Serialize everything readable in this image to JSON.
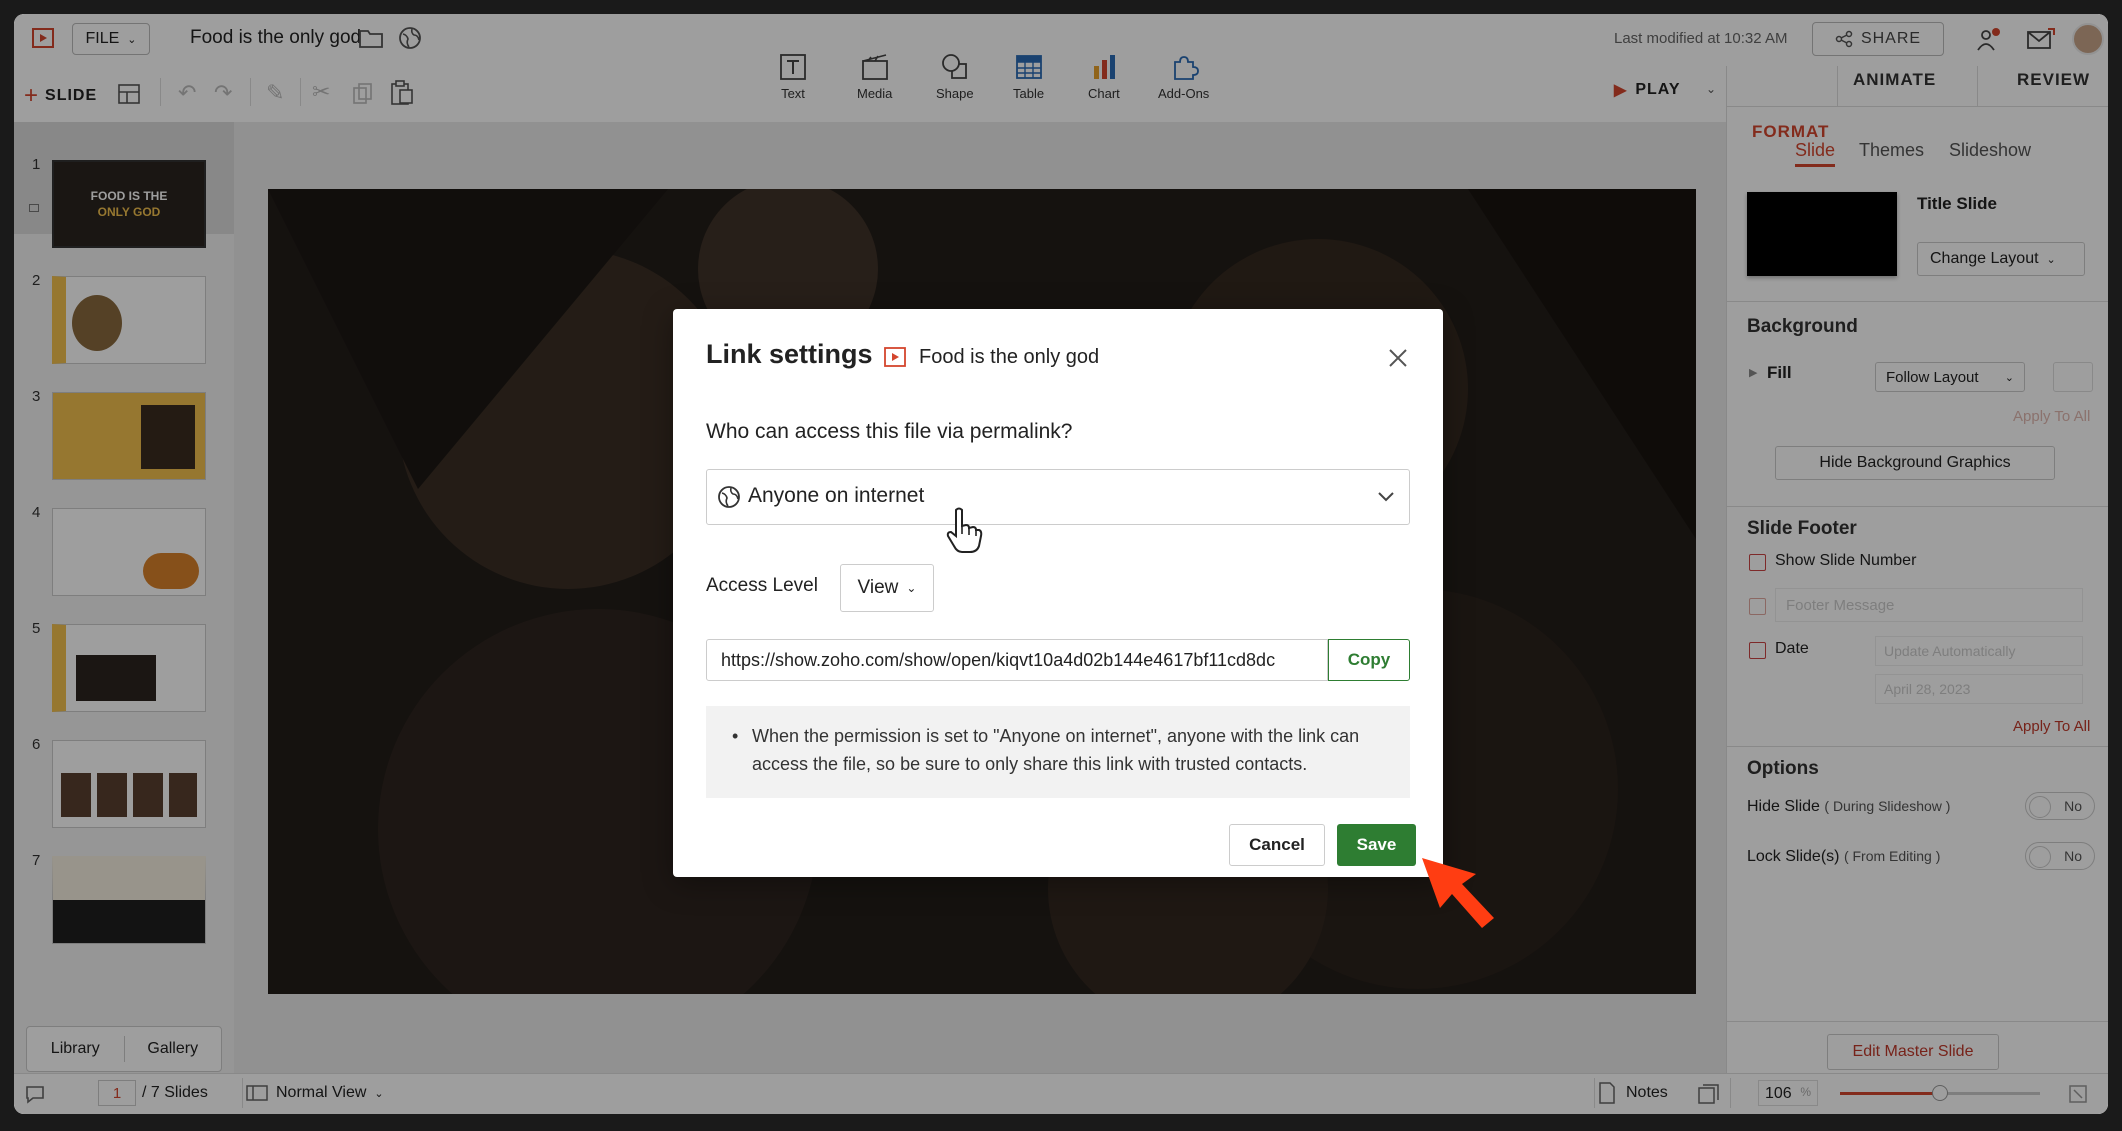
{
  "app": {
    "file_label": "FILE",
    "doc_title": "Food is the only god",
    "last_modified": "Last modified at 10:32 AM",
    "share_label": "SHARE",
    "slide_label": "SLIDE",
    "play_label": "PLAY"
  },
  "insert_tools": [
    {
      "label": "Text",
      "icon": "text-icon"
    },
    {
      "label": "Media",
      "icon": "media-icon"
    },
    {
      "label": "Shape",
      "icon": "shape-icon"
    },
    {
      "label": "Table",
      "icon": "table-icon"
    },
    {
      "label": "Chart",
      "icon": "chart-icon"
    },
    {
      "label": "Add-Ons",
      "icon": "addons-icon"
    }
  ],
  "right_tabs": {
    "format": "FORMAT",
    "animate": "ANIMATE",
    "review": "REVIEW"
  },
  "sub_tabs": {
    "slide": "Slide",
    "themes": "Themes",
    "slideshow": "Slideshow"
  },
  "format_panel": {
    "layout_name": "Title Slide",
    "change_layout": "Change Layout",
    "background_heading": "Background",
    "fill_label": "Fill",
    "fill_value": "Follow Layout",
    "apply_all_1": "Apply To All",
    "hide_bg": "Hide Background Graphics",
    "footer_heading": "Slide Footer",
    "show_slide_number": "Show Slide Number",
    "footer_placeholder": "Footer Message",
    "date_label": "Date",
    "date_mode": "Update Automatically",
    "date_value": "April 28, 2023",
    "apply_all_2": "Apply To All",
    "options_heading": "Options",
    "hide_slide": "Hide Slide",
    "hide_slide_note": "( During Slideshow )",
    "lock_slide": "Lock Slide(s)",
    "lock_slide_note": "( From Editing )",
    "toggle_no": "No",
    "edit_master": "Edit Master Slide"
  },
  "thumbnails": [
    {
      "num": "1",
      "title": "FOOD IS THE",
      "title2": "ONLY GOD"
    },
    {
      "num": "2"
    },
    {
      "num": "3"
    },
    {
      "num": "4"
    },
    {
      "num": "5"
    },
    {
      "num": "6"
    },
    {
      "num": "7"
    }
  ],
  "left_bottom": {
    "library": "Library",
    "gallery": "Gallery"
  },
  "status": {
    "page": "1",
    "total": "/ 7 Slides",
    "view": "Normal View",
    "notes": "Notes",
    "zoom": "106",
    "zoom_unit": "%",
    "zoom_fraction": 0.5
  },
  "dialog": {
    "title": "Link settings",
    "file_name": "Food is the only god",
    "question": "Who can access this file via permalink?",
    "access_option": "Anyone on internet",
    "access_level_label": "Access Level",
    "access_level_value": "View",
    "link_url": "https://show.zoho.com/show/open/kiqvt10a4d02b144e4617bf11cd8dc",
    "copy_label": "Copy",
    "note": "When the permission is set to \"Anyone on internet\", anyone with the link can access the file, so be sure to only share this link with trusted contacts.",
    "cancel_label": "Cancel",
    "save_label": "Save"
  },
  "colors": {
    "accent": "#d4462e",
    "save_green": "#2e7d32",
    "pointer": "#ff3d12"
  }
}
